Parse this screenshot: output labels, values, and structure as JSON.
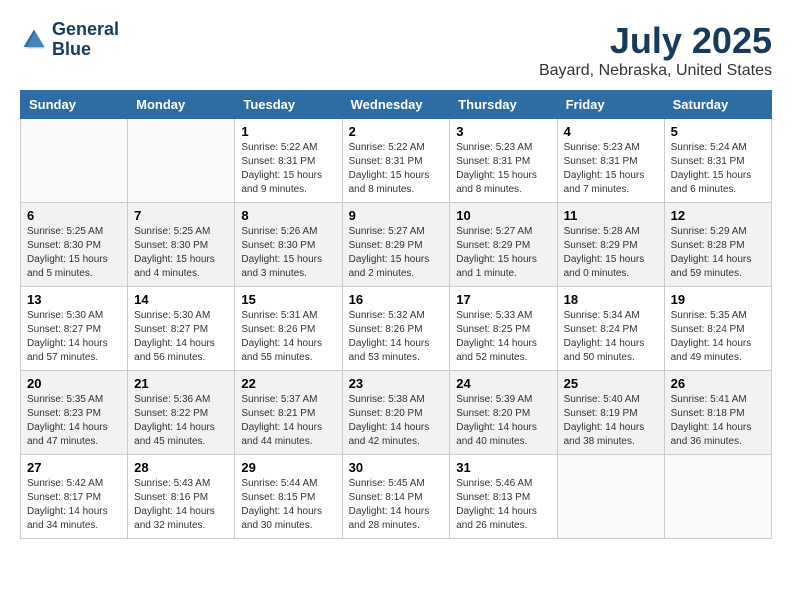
{
  "header": {
    "logo_line1": "General",
    "logo_line2": "Blue",
    "title": "July 2025",
    "subtitle": "Bayard, Nebraska, United States"
  },
  "days_of_week": [
    "Sunday",
    "Monday",
    "Tuesday",
    "Wednesday",
    "Thursday",
    "Friday",
    "Saturday"
  ],
  "weeks": [
    [
      {
        "day": "",
        "info": ""
      },
      {
        "day": "",
        "info": ""
      },
      {
        "day": "1",
        "info": "Sunrise: 5:22 AM\nSunset: 8:31 PM\nDaylight: 15 hours\nand 9 minutes."
      },
      {
        "day": "2",
        "info": "Sunrise: 5:22 AM\nSunset: 8:31 PM\nDaylight: 15 hours\nand 8 minutes."
      },
      {
        "day": "3",
        "info": "Sunrise: 5:23 AM\nSunset: 8:31 PM\nDaylight: 15 hours\nand 8 minutes."
      },
      {
        "day": "4",
        "info": "Sunrise: 5:23 AM\nSunset: 8:31 PM\nDaylight: 15 hours\nand 7 minutes."
      },
      {
        "day": "5",
        "info": "Sunrise: 5:24 AM\nSunset: 8:31 PM\nDaylight: 15 hours\nand 6 minutes."
      }
    ],
    [
      {
        "day": "6",
        "info": "Sunrise: 5:25 AM\nSunset: 8:30 PM\nDaylight: 15 hours\nand 5 minutes."
      },
      {
        "day": "7",
        "info": "Sunrise: 5:25 AM\nSunset: 8:30 PM\nDaylight: 15 hours\nand 4 minutes."
      },
      {
        "day": "8",
        "info": "Sunrise: 5:26 AM\nSunset: 8:30 PM\nDaylight: 15 hours\nand 3 minutes."
      },
      {
        "day": "9",
        "info": "Sunrise: 5:27 AM\nSunset: 8:29 PM\nDaylight: 15 hours\nand 2 minutes."
      },
      {
        "day": "10",
        "info": "Sunrise: 5:27 AM\nSunset: 8:29 PM\nDaylight: 15 hours\nand 1 minute."
      },
      {
        "day": "11",
        "info": "Sunrise: 5:28 AM\nSunset: 8:29 PM\nDaylight: 15 hours\nand 0 minutes."
      },
      {
        "day": "12",
        "info": "Sunrise: 5:29 AM\nSunset: 8:28 PM\nDaylight: 14 hours\nand 59 minutes."
      }
    ],
    [
      {
        "day": "13",
        "info": "Sunrise: 5:30 AM\nSunset: 8:27 PM\nDaylight: 14 hours\nand 57 minutes."
      },
      {
        "day": "14",
        "info": "Sunrise: 5:30 AM\nSunset: 8:27 PM\nDaylight: 14 hours\nand 56 minutes."
      },
      {
        "day": "15",
        "info": "Sunrise: 5:31 AM\nSunset: 8:26 PM\nDaylight: 14 hours\nand 55 minutes."
      },
      {
        "day": "16",
        "info": "Sunrise: 5:32 AM\nSunset: 8:26 PM\nDaylight: 14 hours\nand 53 minutes."
      },
      {
        "day": "17",
        "info": "Sunrise: 5:33 AM\nSunset: 8:25 PM\nDaylight: 14 hours\nand 52 minutes."
      },
      {
        "day": "18",
        "info": "Sunrise: 5:34 AM\nSunset: 8:24 PM\nDaylight: 14 hours\nand 50 minutes."
      },
      {
        "day": "19",
        "info": "Sunrise: 5:35 AM\nSunset: 8:24 PM\nDaylight: 14 hours\nand 49 minutes."
      }
    ],
    [
      {
        "day": "20",
        "info": "Sunrise: 5:35 AM\nSunset: 8:23 PM\nDaylight: 14 hours\nand 47 minutes."
      },
      {
        "day": "21",
        "info": "Sunrise: 5:36 AM\nSunset: 8:22 PM\nDaylight: 14 hours\nand 45 minutes."
      },
      {
        "day": "22",
        "info": "Sunrise: 5:37 AM\nSunset: 8:21 PM\nDaylight: 14 hours\nand 44 minutes."
      },
      {
        "day": "23",
        "info": "Sunrise: 5:38 AM\nSunset: 8:20 PM\nDaylight: 14 hours\nand 42 minutes."
      },
      {
        "day": "24",
        "info": "Sunrise: 5:39 AM\nSunset: 8:20 PM\nDaylight: 14 hours\nand 40 minutes."
      },
      {
        "day": "25",
        "info": "Sunrise: 5:40 AM\nSunset: 8:19 PM\nDaylight: 14 hours\nand 38 minutes."
      },
      {
        "day": "26",
        "info": "Sunrise: 5:41 AM\nSunset: 8:18 PM\nDaylight: 14 hours\nand 36 minutes."
      }
    ],
    [
      {
        "day": "27",
        "info": "Sunrise: 5:42 AM\nSunset: 8:17 PM\nDaylight: 14 hours\nand 34 minutes."
      },
      {
        "day": "28",
        "info": "Sunrise: 5:43 AM\nSunset: 8:16 PM\nDaylight: 14 hours\nand 32 minutes."
      },
      {
        "day": "29",
        "info": "Sunrise: 5:44 AM\nSunset: 8:15 PM\nDaylight: 14 hours\nand 30 minutes."
      },
      {
        "day": "30",
        "info": "Sunrise: 5:45 AM\nSunset: 8:14 PM\nDaylight: 14 hours\nand 28 minutes."
      },
      {
        "day": "31",
        "info": "Sunrise: 5:46 AM\nSunset: 8:13 PM\nDaylight: 14 hours\nand 26 minutes."
      },
      {
        "day": "",
        "info": ""
      },
      {
        "day": "",
        "info": ""
      }
    ]
  ]
}
